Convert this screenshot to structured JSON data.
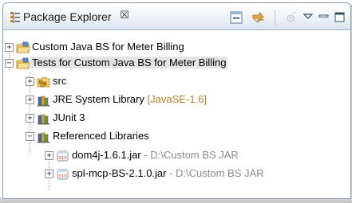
{
  "view": {
    "title": "Package Explorer",
    "close_glyph": "☒",
    "toolbar": {
      "collapse_all": "collapse-all-icon",
      "link_with_editor": "link-with-editor-icon",
      "view_menu": "view-menu-icon",
      "minimize": "minimize-icon",
      "maximize": "maximize-icon"
    }
  },
  "tree": [
    {
      "expander": "+",
      "icon": "project-folder-icon",
      "label": "Custom Java BS for Meter Billing",
      "decoration": "",
      "selected": false
    },
    {
      "expander": "−",
      "icon": "project-folder-icon",
      "label": "Tests for Custom Java BS for Meter Billing",
      "decoration": "",
      "selected": true
    },
    {
      "expander": "+",
      "icon": "source-folder-icon",
      "label": "src",
      "decoration": "",
      "selected": false
    },
    {
      "expander": "+",
      "icon": "library-icon",
      "label": "JRE System Library",
      "decoration": "[JavaSE-1.6]",
      "selected": false
    },
    {
      "expander": "+",
      "icon": "library-icon",
      "label": "JUnit 3",
      "decoration": "",
      "selected": false
    },
    {
      "expander": "−",
      "icon": "library-icon",
      "label": "Referenced Libraries",
      "decoration": "",
      "selected": false
    },
    {
      "expander": "+",
      "icon": "jar-icon",
      "label": "dom4j-1.6.1.jar",
      "decoration": " - D:\\Custom BS JAR",
      "selected": false
    },
    {
      "expander": "+",
      "icon": "jar-icon",
      "label": "spl-mcp-BS-2.1.0.jar",
      "decoration": " - D:\\Custom BS JAR",
      "selected": false
    }
  ],
  "colors": {
    "decoration": "#8a8a8a",
    "jre_decoration": "#b57f2a",
    "selection": "#e4e4e4",
    "frame_border": "#8a9cb8"
  }
}
